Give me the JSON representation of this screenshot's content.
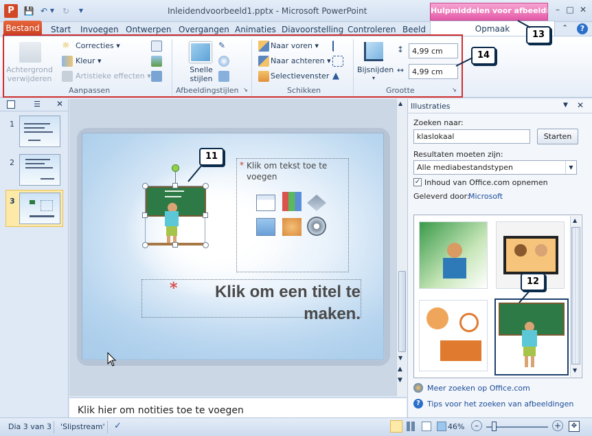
{
  "window": {
    "title": "Inleidendvoorbeeld1.pptx - Microsoft PowerPoint",
    "context_tab": "Hulpmiddelen voor afbeeldi...",
    "app_icon": "P"
  },
  "tabs": [
    "Bestand",
    "Start",
    "Invoegen",
    "Ontwerpen",
    "Overgangen",
    "Animaties",
    "Diavoorstelling",
    "Controleren",
    "Beeld"
  ],
  "active_tab": "Opmaak",
  "ribbon": {
    "aanpassen": {
      "label": "Aanpassen",
      "achtergrond": "Achtergrond verwijderen",
      "correcties": "Correcties",
      "kleur": "Kleur",
      "artistiek": "Artistieke effecten"
    },
    "stijlen": {
      "label": "Afbeeldingstijlen",
      "snelle": "Snelle stijlen"
    },
    "schikken": {
      "label": "Schikken",
      "naar_voren": "Naar voren",
      "naar_achteren": "Naar achteren",
      "selectievenster": "Selectievenster"
    },
    "grootte": {
      "label": "Grootte",
      "bijsnijden": "Bijsnijden",
      "height": "4,99 cm",
      "width": "4,99 cm"
    }
  },
  "callouts": [
    "11",
    "12",
    "13",
    "14"
  ],
  "slides": {
    "numbers": [
      "1",
      "2",
      "3"
    ],
    "active": "3"
  },
  "slide": {
    "content_placeholder": "Klik om tekst toe te voegen",
    "title_placeholder": "Klik om een titel te maken.",
    "bullet": "*"
  },
  "notes": "Klik hier om notities toe te voegen",
  "taskpane": {
    "title": "Illustraties",
    "search_label": "Zoeken naar:",
    "search_value": "klaslokaal",
    "search_button": "Starten",
    "results_label": "Resultaten moeten zijn:",
    "results_value": "Alle mediabestandstypen",
    "include_label": "Inhoud van Office.com opnemen",
    "include_checked": true,
    "provider_label": "Geleverd door:",
    "provider_link": "Microsoft",
    "more_link": "Meer zoeken op Office.com",
    "tips_link": "Tips voor het zoeken van afbeeldingen"
  },
  "status": {
    "slide_info": "Dia 3 van 3",
    "theme": "'Slipstream'",
    "zoom": "46%"
  }
}
